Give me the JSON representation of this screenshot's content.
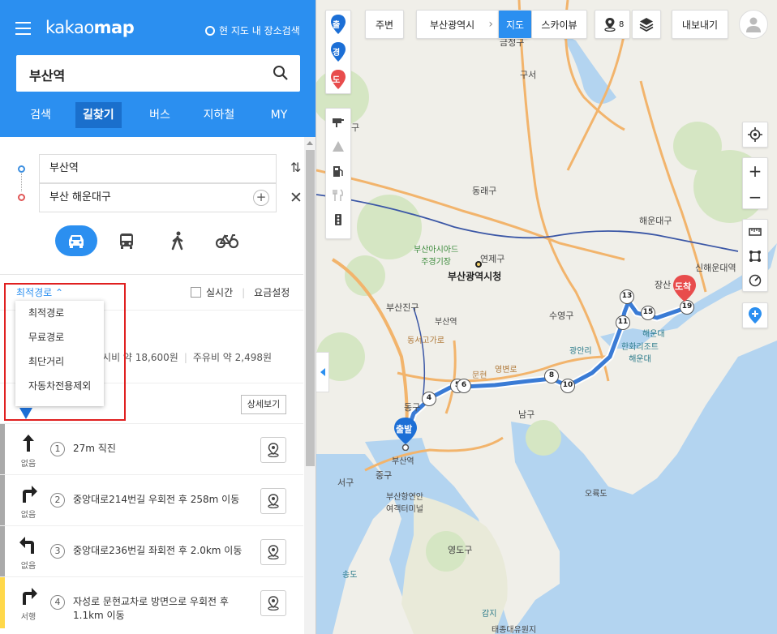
{
  "app": {
    "logo_a": "kakao",
    "logo_b": "map",
    "here_search": "현 지도 내 장소검색"
  },
  "search": {
    "value": "부산역"
  },
  "nav_tabs": [
    {
      "label": "검색"
    },
    {
      "label": "길찾기"
    },
    {
      "label": "버스"
    },
    {
      "label": "지하철"
    },
    {
      "label": "MY"
    }
  ],
  "route": {
    "origin": "부산역",
    "destination": "부산 해운대구"
  },
  "options": {
    "selected": "최적경로",
    "realtime": "실시간",
    "fare_settings": "요금설정",
    "dropdown": [
      "최적경로",
      "무료경로",
      "최단거리",
      "자동차전용제외"
    ]
  },
  "summary": {
    "taxi": "택시비 약 18,600원",
    "fuel": "주유비 약 2,498원"
  },
  "detail_button": "상세보기",
  "steps": [
    {
      "num": "1",
      "text": "27m 직진",
      "congestion": "없음",
      "arrow": "straight"
    },
    {
      "num": "2",
      "text": "중앙대로214번길 우회전 후 258m 이동",
      "congestion": "없음",
      "arrow": "right"
    },
    {
      "num": "3",
      "text": "중앙대로236번길 좌회전 후 2.0km 이동",
      "congestion": "없음",
      "arrow": "left"
    },
    {
      "num": "4",
      "text": "자성로 문현교차로 방면으로 우회전 후 1.1km 이동",
      "congestion": "서행",
      "arrow": "right"
    }
  ],
  "map": {
    "topbar": {
      "nearby": "주변",
      "region": "부산광역시",
      "map_tab": "지도",
      "skyview_tab": "스카이뷰",
      "export": "내보내기",
      "partial": "8"
    },
    "markers": {
      "start": "출",
      "via": "경",
      "end": "도",
      "start_pin": "출발",
      "end_pin": "도착"
    },
    "labels": {
      "geumjeong": "금정구",
      "gu1": "구",
      "guseo": "구서",
      "dongnae": "동래구",
      "yeonje": "연제구",
      "citycorner": "부산아시아드\n주경기장",
      "cityhall": "부산광역시청",
      "haeundae_gu": "해운대구",
      "shinhaeundae": "신해운대역",
      "jangsan": "장산",
      "busanjin": "부산진구",
      "seomyeon": "부산역",
      "suyeong": "수영구",
      "gwangan": "광안리",
      "haeundae": "해운대",
      "haeundae_beach": "한화리조트\n해운대",
      "nam": "남구",
      "dong": "동구",
      "jung": "중구",
      "seo": "서구",
      "yeongdo": "영도구",
      "busan_station": "부산역",
      "ferry": "부산항연안\n여객터미널",
      "oryukdo": "오륙도",
      "songdo": "송도",
      "gamji": "감지",
      "taejongdae": "태종대유원지",
      "dongseo": "동서고가로",
      "munhyeon": "문현",
      "yeongbyeon": "영변로"
    },
    "route_nodes": [
      "4",
      "5",
      "6",
      "8",
      "10",
      "11",
      "13",
      "15",
      "19"
    ],
    "accent": "#2b8ff0",
    "route_color": "#3a7bd5",
    "end_color": "#e84c4c"
  }
}
